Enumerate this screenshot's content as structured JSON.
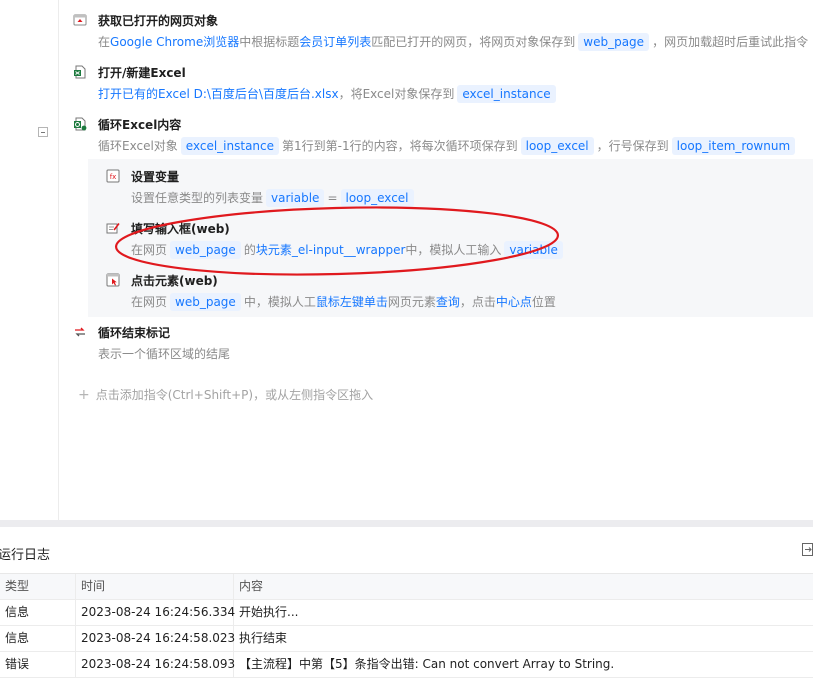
{
  "workflow": {
    "steps": [
      {
        "id": "get-page",
        "title": "获取已打开的网页对象",
        "desc": [
          {
            "t": "text",
            "v": "在"
          },
          {
            "t": "kw",
            "v": "Google Chrome浏览器"
          },
          {
            "t": "text",
            "v": "中根据标题"
          },
          {
            "t": "kw",
            "v": "会员订单列表"
          },
          {
            "t": "text",
            "v": "匹配已打开的网页，将网页对象保存到"
          },
          {
            "t": "var",
            "v": "web_page"
          },
          {
            "t": "text",
            "v": "，网页加载超时后重试此指令"
          }
        ]
      },
      {
        "id": "open-excel",
        "title": "打开/新建Excel",
        "desc": [
          {
            "t": "kw",
            "v": "打开已有的Excel D:\\百度后台\\百度后台.xlsx"
          },
          {
            "t": "text",
            "v": "，将Excel对象保存到"
          },
          {
            "t": "var",
            "v": "excel_instance"
          }
        ]
      },
      {
        "id": "loop-excel",
        "title": "循环Excel内容",
        "desc": [
          {
            "t": "text",
            "v": "循环Excel对象"
          },
          {
            "t": "var",
            "v": "excel_instance"
          },
          {
            "t": "text",
            "v": "第1行到第-1行的内容，将每次循环项保存到"
          },
          {
            "t": "var",
            "v": "loop_excel"
          },
          {
            "t": "text",
            "v": "，行号保存到"
          },
          {
            "t": "var",
            "v": "loop_item_rownum"
          }
        ]
      },
      {
        "id": "set-variable",
        "title": "设置变量",
        "desc": [
          {
            "t": "text",
            "v": "设置任意类型的列表变量"
          },
          {
            "t": "var",
            "v": "variable"
          },
          {
            "t": "text",
            "v": "="
          },
          {
            "t": "var",
            "v": "loop_excel"
          }
        ]
      },
      {
        "id": "fill-input",
        "title": "填写输入框(web)",
        "desc": [
          {
            "t": "text",
            "v": "在网页"
          },
          {
            "t": "var",
            "v": "web_page"
          },
          {
            "t": "text",
            "v": "的"
          },
          {
            "t": "kw",
            "v": "块元素_el-input__wrapper"
          },
          {
            "t": "text",
            "v": "中，模拟人工输入"
          },
          {
            "t": "var",
            "v": "variable"
          }
        ]
      },
      {
        "id": "click-element",
        "title": "点击元素(web)",
        "desc": [
          {
            "t": "text",
            "v": "在网页"
          },
          {
            "t": "var",
            "v": "web_page"
          },
          {
            "t": "text",
            "v": "中，模拟人工"
          },
          {
            "t": "kw",
            "v": "鼠标左键单击"
          },
          {
            "t": "text",
            "v": "网页元素"
          },
          {
            "t": "kw",
            "v": "查询"
          },
          {
            "t": "text",
            "v": "，点击"
          },
          {
            "t": "kw",
            "v": "中心点"
          },
          {
            "t": "text",
            "v": "位置"
          }
        ]
      },
      {
        "id": "loop-end",
        "title": "循环结束标记",
        "desc": [
          {
            "t": "text",
            "v": "表示一个循环区域的结尾"
          }
        ]
      }
    ],
    "add_hint": "点击添加指令(Ctrl+Shift+P)，或从左侧指令区拖入"
  },
  "log": {
    "title": "运行日志",
    "columns": [
      "类型",
      "时间",
      "内容"
    ],
    "rows": [
      {
        "type": "信息",
        "time": "2023-08-24 16:24:56.334",
        "content": "开始执行..."
      },
      {
        "type": "信息",
        "time": "2023-08-24 16:24:58.023",
        "content": "执行结束"
      },
      {
        "type": "错误",
        "time": "2023-08-24 16:24:58.093",
        "content": "【主流程】中第【5】条指令出错: Can not convert Array to String."
      }
    ]
  },
  "colors": {
    "accent": "#1677ff",
    "annotation": "#e0191e"
  }
}
